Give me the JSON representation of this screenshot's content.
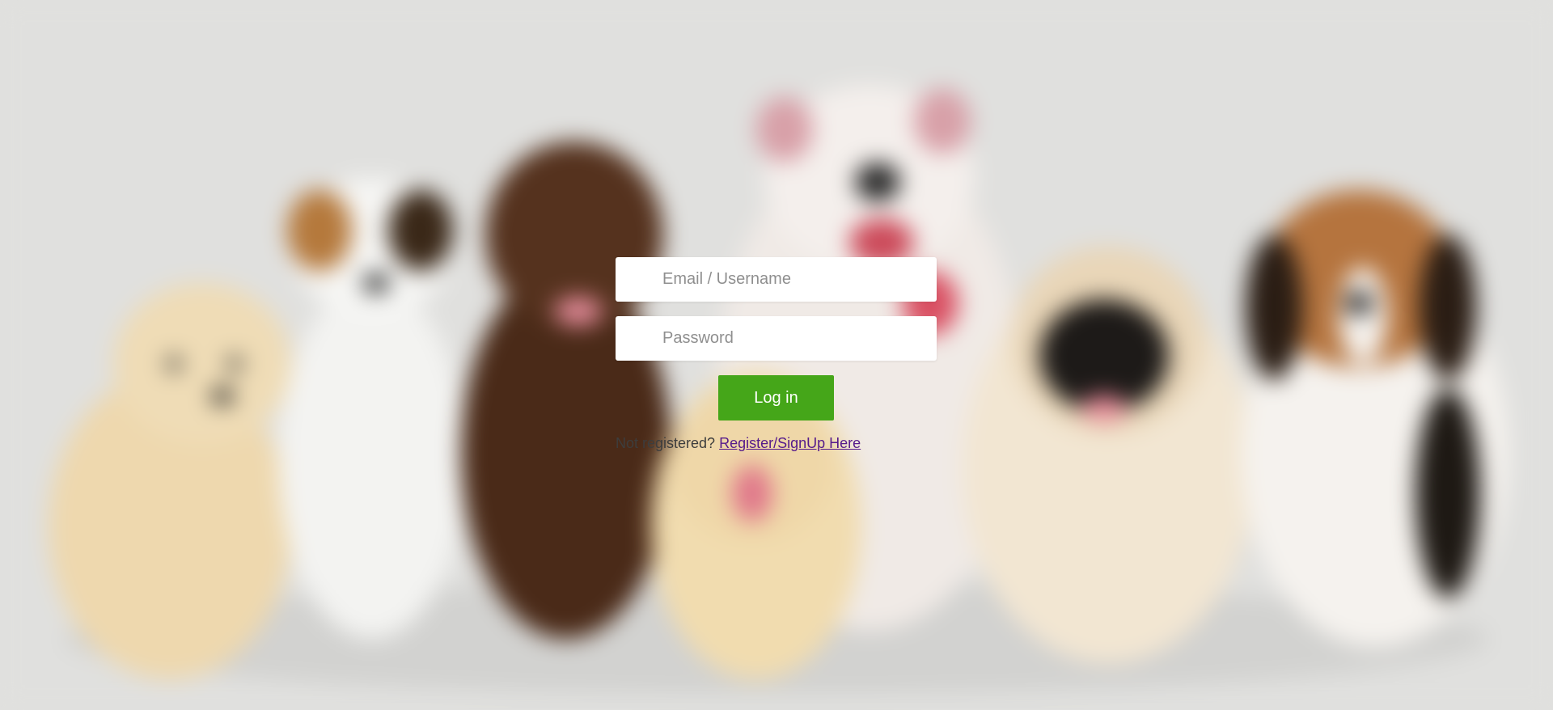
{
  "login": {
    "email_placeholder": "Email / Username",
    "email_value": "",
    "password_placeholder": "Password",
    "password_value": "",
    "login_button_label": "Log in",
    "register_prompt": "Not registered?",
    "register_link_label": "Register/SignUp Here"
  },
  "colors": {
    "background": "#e0e0de",
    "login_button": "#45a619",
    "link": "#551a8b"
  }
}
